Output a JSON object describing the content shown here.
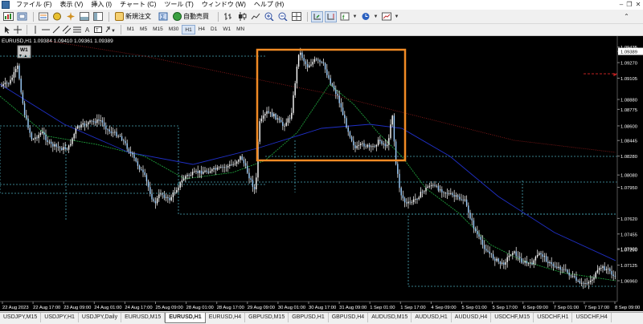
{
  "menu": {
    "items": [
      "ファイル (F)",
      "表示 (V)",
      "挿入 (I)",
      "チャート (C)",
      "ツール (T)",
      "ウィンドウ (W)",
      "ヘルプ (H)"
    ]
  },
  "toolbar": {
    "new_order_label": "新規注文",
    "autotrading_label": "自動売買",
    "timeframes": [
      "M1",
      "M5",
      "M15",
      "M30",
      "H1",
      "H4",
      "D1",
      "W1",
      "MN"
    ]
  },
  "chart": {
    "info_line": "EURUSD,H1  1.09384 1.09410 1.09361 1.09389",
    "indicator_badge": "W1",
    "price_labels": [
      "1.09435",
      "1.09389",
      "1.09270",
      "1.09105",
      "1.08880",
      "1.08775",
      "1.08600",
      "1.08445",
      "1.08280",
      "1.08080",
      "1.07950",
      "1.07620",
      "1.07455",
      "1.07300",
      "1.07290",
      "1.07125",
      "1.06960"
    ],
    "current_price": "1.09389",
    "time_labels": [
      "22 Aug 2023",
      "22 Aug 17:00",
      "23 Aug 09:00",
      "24 Aug 01:00",
      "24 Aug 17:00",
      "25 Aug 09:00",
      "28 Aug 01:00",
      "28 Aug 17:00",
      "29 Aug 09:00",
      "30 Aug 01:00",
      "30 Aug 17:00",
      "31 Aug 09:00",
      "1 Sep 01:00",
      "1 Sep 17:00",
      "4 Sep 09:00",
      "5 Sep 01:00",
      "5 Sep 17:00",
      "6 Sep 09:00",
      "7 Sep 01:00",
      "7 Sep 17:00",
      "8 Sep 09:00"
    ],
    "highlight_color": "#f08a24",
    "candle_color": "#ffffff",
    "ma_fast_color": "#1e9b3a",
    "ma_mid_color": "#2030c8",
    "ma_slow_color": "#8a1a1a",
    "level_color": "#4aa8b8"
  },
  "tabs": [
    "USDJPY,M15",
    "USDJPY,H1",
    "USDJPY,Daily",
    "EURUSD,M15",
    "EURUSD,H1",
    "EURUSD,H4",
    "GBPUSD,M15",
    "GBPUSD,H1",
    "GBPUSD,H4",
    "AUDUSD,M15",
    "AUDUSD,H1",
    "AUDUSD,H4",
    "USDCHF,M15",
    "USDCHF,H1",
    "USDCHF,H4"
  ],
  "active_tab": "EURUSD,H1"
}
